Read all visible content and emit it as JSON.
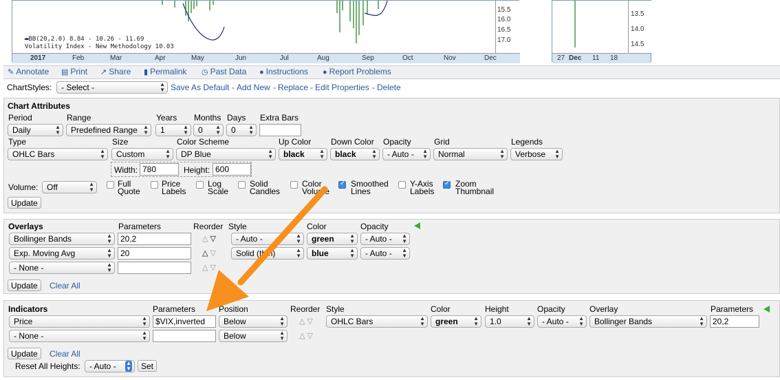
{
  "chart": {
    "legend_line1": "BB(20,2.0) 8.84 - 10.26 - 11.69",
    "legend_line2": "Volatility Index - New Methodology 10.03",
    "y_labels": [
      "15.5",
      "16.0",
      "16.5",
      "17.0"
    ],
    "x_labels": [
      "2017",
      "Feb",
      "Mar",
      "Apr",
      "May",
      "Jun",
      "Jul",
      "Aug",
      "Sep",
      "Oct",
      "Nov",
      "Dec"
    ],
    "thumb_y_labels": [
      "13.5",
      "14.0",
      "14.5"
    ],
    "thumb_x_labels": [
      "27",
      "Dec",
      "11",
      "18"
    ],
    "colors": {
      "price": "#1a7a1a",
      "band": "#222a8a",
      "background": "#aac8e8"
    }
  },
  "toolbar": {
    "annotate": "Annotate",
    "print": "Print",
    "share": "Share",
    "permalink": "Permalink",
    "past_data": "Past Data",
    "instructions": "Instructions",
    "report": "Report Problems"
  },
  "chartstyles": {
    "label": "ChartStyles:",
    "select": "- Select -",
    "save_default": "Save As Default",
    "add_new": "Add New",
    "replace": "Replace",
    "edit": "Edit Properties",
    "delete": "Delete"
  },
  "attributes": {
    "title": "Chart Attributes",
    "period_label": "Period",
    "period": "Daily",
    "range_label": "Range",
    "range": "Predefined Range",
    "years_label": "Years",
    "years": "1",
    "months_label": "Months",
    "months": "0",
    "days_label": "Days",
    "days": "0",
    "extra_label": "Extra Bars",
    "extra": "",
    "type_label": "Type",
    "type": "OHLC Bars",
    "size_label": "Size",
    "size": "Custom",
    "scheme_label": "Color Scheme",
    "scheme": "DP Blue",
    "up_label": "Up Color",
    "up": "black",
    "down_label": "Down Color",
    "down": "black",
    "opacity_label": "Opacity",
    "opacity": "- Auto -",
    "grid_label": "Grid",
    "grid": "Normal",
    "legends_label": "Legends",
    "legends": "Verbose",
    "width_label": "Width:",
    "width": "780",
    "height_label": "Height:",
    "height": "600",
    "volume_label": "Volume:",
    "volume": "Off",
    "checkboxes": [
      {
        "l1": "Full",
        "l2": "Quote",
        "checked": false
      },
      {
        "l1": "Price",
        "l2": "Labels",
        "checked": false
      },
      {
        "l1": "Log",
        "l2": "Scale",
        "checked": false
      },
      {
        "l1": "Solid",
        "l2": "Candles",
        "checked": false
      },
      {
        "l1": "Color",
        "l2": "Volume",
        "checked": false
      },
      {
        "l1": "Smoothed",
        "l2": "Lines",
        "checked": true
      },
      {
        "l1": "Y-Axis",
        "l2": "Labels",
        "checked": false
      },
      {
        "l1": "Zoom",
        "l2": "Thumbnail",
        "checked": true
      }
    ],
    "update": "Update"
  },
  "overlays": {
    "title": "Overlays",
    "params_label": "Parameters",
    "reorder_label": "Reorder",
    "style_label": "Style",
    "color_label": "Color",
    "opacity_label": "Opacity",
    "rows": [
      {
        "name": "Bollinger Bands",
        "params": "20,2",
        "style": "- Auto -",
        "color": "green",
        "opacity": "- Auto -"
      },
      {
        "name": "Exp. Moving Avg",
        "params": "20",
        "style": "Solid (thin)",
        "color": "blue",
        "opacity": "- Auto -"
      },
      {
        "name": "- None -",
        "params": ""
      }
    ],
    "update": "Update",
    "clear": "Clear All"
  },
  "indicators": {
    "title": "Indicators",
    "params_label": "Parameters",
    "position_label": "Position",
    "reorder_label": "Reorder",
    "style_label": "Style",
    "color_label": "Color",
    "height_label": "Height",
    "opacity_label": "Opacity",
    "overlay_label": "Overlay",
    "params2_label": "Parameters",
    "rows": [
      {
        "name": "Price",
        "params": "$VIX,inverted",
        "position": "Below",
        "style": "OHLC Bars",
        "color": "green",
        "height": "1.0",
        "opacity": "- Auto -",
        "overlay": "Bollinger Bands",
        "params2": "20,2"
      },
      {
        "name": "- None -",
        "params": "",
        "position": "Below"
      }
    ],
    "update": "Update",
    "clear": "Clear All",
    "reset_label": "Reset All Heights:",
    "reset_value": "- Auto -",
    "set": "Set"
  },
  "annotation_arrow": {
    "color": "#f7901e"
  }
}
